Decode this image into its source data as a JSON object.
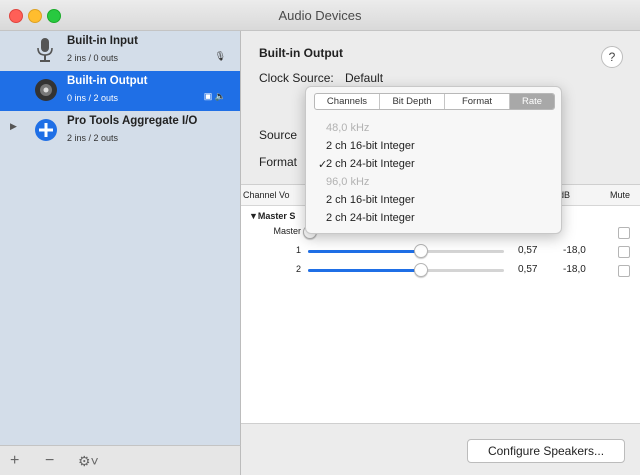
{
  "window": {
    "title": "Audio Devices"
  },
  "colors": {
    "selection": "#1f6fe6",
    "sidebar": "#d3dde9",
    "close": "#ff5f57",
    "minimize": "#ffbd2e",
    "maximize": "#28c940"
  },
  "sidebar": {
    "devices": [
      {
        "name": "Built-in Input",
        "sub": "2 ins / 0 outs",
        "icon": "microphone-icon",
        "badge": "🎙"
      },
      {
        "name": "Built-in Output",
        "sub": "0 ins / 2 outs",
        "icon": "speaker-icon",
        "badge": "▣ 🔈"
      },
      {
        "name": "Pro Tools Aggregate I/O",
        "sub": "2 ins / 2 outs",
        "icon": "plus-circle-icon",
        "disclosure": "▶"
      }
    ],
    "bottom": {
      "add": "+",
      "remove": "−",
      "gear": "⚙˅"
    }
  },
  "main": {
    "device_title": "Built-in Output",
    "help": "?",
    "clock_source_label": "Clock Source:",
    "clock_source_value": "Default",
    "source_label": "Source",
    "format_label": "Format",
    "table": {
      "headers": {
        "channel": "Channel Vo",
        "db": "dB",
        "mute": "Mute"
      },
      "group": "▼Master S",
      "rows": [
        {
          "label": "Master",
          "value": "",
          "db": "",
          "level": 0
        },
        {
          "label": "1",
          "value": "0,57",
          "db": "-18,0",
          "level": 0.57
        },
        {
          "label": "2",
          "value": "0,57",
          "db": "-18,0",
          "level": 0.57
        }
      ]
    },
    "configure_button": "Configure Speakers..."
  },
  "popover": {
    "tabs": [
      "Channels",
      "Bit Depth",
      "Format",
      "Rate"
    ],
    "active_tab": "Rate",
    "items": [
      {
        "text": "48,0 kHz",
        "disabled": true,
        "checked": false
      },
      {
        "text": "2 ch 16-bit Integer",
        "disabled": false,
        "checked": false
      },
      {
        "text": "2 ch 24-bit Integer",
        "disabled": false,
        "checked": true
      },
      {
        "text": "96,0 kHz",
        "disabled": true,
        "checked": false
      },
      {
        "text": "2 ch 16-bit Integer",
        "disabled": false,
        "checked": false
      },
      {
        "text": "2 ch 24-bit Integer",
        "disabled": false,
        "checked": false
      }
    ],
    "checkmark": "✓"
  }
}
